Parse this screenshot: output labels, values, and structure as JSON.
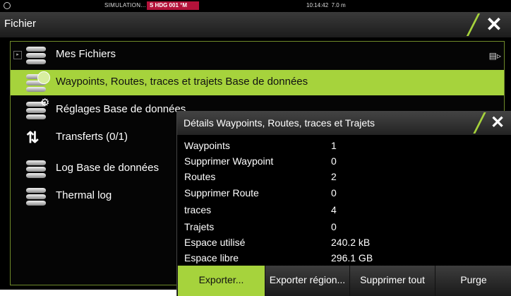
{
  "status_bar": {
    "mode": "SIMULATION...",
    "heading": "S HDG 001 °M",
    "time": "10:14:42",
    "depth": "7.0 m"
  },
  "window": {
    "title": "Fichier",
    "close_icon": "close-icon"
  },
  "file_list": {
    "items": [
      {
        "label": "Mes Fichiers",
        "icon": "database-icon"
      },
      {
        "label": "Waypoints, Routes, traces et trajets Base de données",
        "icon": "database-globe-icon",
        "selected": true
      },
      {
        "label": "Réglages Base de données",
        "icon": "database-gear-icon"
      },
      {
        "label": "Transferts (0/1)",
        "icon": "transfer-arrows-icon"
      },
      {
        "label": "Log Base de données",
        "icon": "database-icon"
      },
      {
        "label": "Thermal log",
        "icon": "database-icon"
      }
    ]
  },
  "dialog": {
    "title": "Détails Waypoints, Routes, traces et Trajets",
    "rows": [
      {
        "key": "Waypoints",
        "value": "1"
      },
      {
        "key": "Supprimer Waypoint",
        "value": "0"
      },
      {
        "key": "Routes",
        "value": "2"
      },
      {
        "key": "Supprimer Route",
        "value": "0"
      },
      {
        "key": "traces",
        "value": "4"
      },
      {
        "key": "Trajets",
        "value": "0"
      },
      {
        "key": "Espace utilisé",
        "value": "240.2 kB"
      },
      {
        "key": "Espace libre",
        "value": "296.1 GB"
      }
    ],
    "buttons": {
      "export": "Exporter...",
      "export_region": "Exporter région...",
      "delete_all": "Supprimer tout",
      "purge": "Purge"
    }
  },
  "colors": {
    "accent": "#a6d33c",
    "heading_badge": "#b3123a",
    "background": "#000000"
  }
}
